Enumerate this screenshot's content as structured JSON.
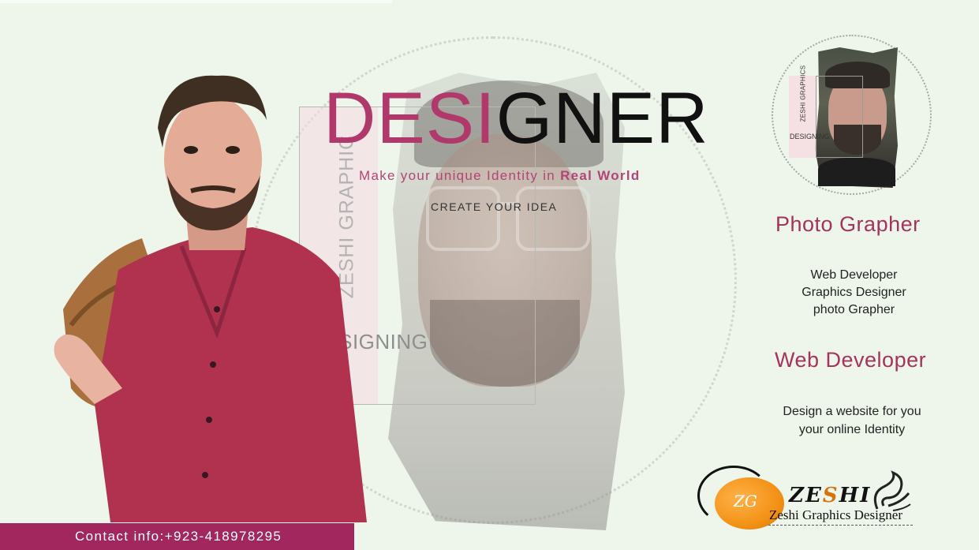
{
  "headline": {
    "part1": "DESI",
    "part2": "GNER"
  },
  "tagline": {
    "lead": "Make your unique Identity in ",
    "emphasis": "Real World"
  },
  "cta": "CREATE YOUR IDEA",
  "brand_vertical": "ZESHI GRAPHIC",
  "designing_label": "DESIGNING",
  "badge": {
    "vertical": "ZESHI GRAPHICS",
    "label": "DESIGNING"
  },
  "photo_heading": "Photo Grapher",
  "roles": [
    "Web Developer",
    "Graphics Designer",
    "photo Grapher"
  ],
  "web_heading": "Web Developer",
  "web_desc": [
    "Design a website for you",
    "your online Identity"
  ],
  "contact": "Contact info:+923-418978295",
  "logo": {
    "mark": "ZG",
    "name_a": "ZE",
    "name_b": "S",
    "name_c": "HI",
    "subtitle": "Zeshi Graphics Designer"
  },
  "colors": {
    "accent": "#a6325e",
    "headline_pink": "#b0386a",
    "contact_bar": "#a1275e",
    "logo_orange": "#f39216",
    "background": "#eef6ec"
  },
  "icons": [
    "person-portrait",
    "chain-ring",
    "logo-orb-icon",
    "swirl-ornament-icon"
  ]
}
